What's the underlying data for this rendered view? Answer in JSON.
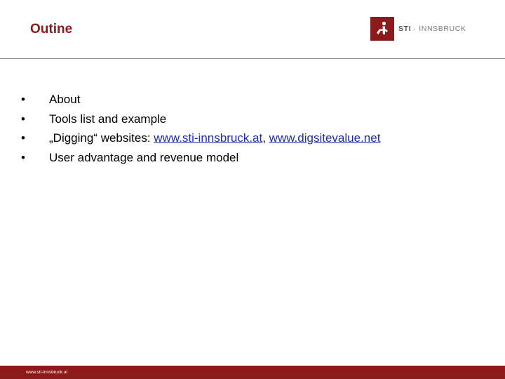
{
  "slide": {
    "title": "Outine"
  },
  "logo": {
    "brand_bold": "STI",
    "brand_rest": " · INNSBRUCK",
    "icon": "sti-logo-icon",
    "color": "#8b1a1a"
  },
  "bullets": {
    "marker": "•",
    "items": [
      {
        "text": "About"
      },
      {
        "text": "Tools list and example"
      },
      {
        "prefix": "„Digging“ websites: ",
        "link1": "www.sti-innsbruck.at",
        "sep": ", ",
        "link2": "www.digsitevalue.net"
      },
      {
        "text": "User advantage and revenue model"
      }
    ]
  },
  "footer": {
    "url": "www.sti-innsbruck.at",
    "color": "#8b1a1a"
  }
}
